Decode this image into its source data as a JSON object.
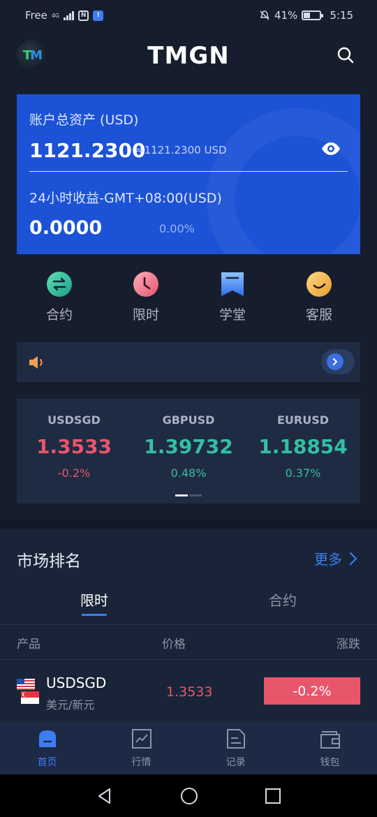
{
  "status_bar": {
    "carrier": "Free",
    "network": "4G",
    "battery": "41%",
    "time": "5:15",
    "battery_level": 0.41
  },
  "header": {
    "logo_text": "TM",
    "title": "TMGN"
  },
  "asset_card": {
    "total_label": "账户总资产 (USD)",
    "total_value": "1121.2300",
    "total_approx": "≈1121.2300 USD",
    "profit_label": "24小时收益-GMT+08:00(USD)",
    "profit_value": "0.0000",
    "profit_pct": "0.00%",
    "bg_color": "#1b52d6"
  },
  "quick_actions": [
    {
      "label": "合约",
      "icon": "swap-icon"
    },
    {
      "label": "限时",
      "icon": "clock-icon"
    },
    {
      "label": "学堂",
      "icon": "bookmark-icon"
    },
    {
      "label": "客服",
      "icon": "smile-icon"
    }
  ],
  "tickers": [
    {
      "symbol": "USDSGD",
      "price": "1.3533",
      "change": "-0.2%",
      "trend": "down"
    },
    {
      "symbol": "GBPUSD",
      "price": "1.39732",
      "change": "0.48%",
      "trend": "up"
    },
    {
      "symbol": "EURUSD",
      "price": "1.18854",
      "change": "0.37%",
      "trend": "up"
    }
  ],
  "market": {
    "title": "市场排名",
    "more": "更多",
    "tabs": [
      "限时",
      "合约"
    ],
    "active_tab": 0,
    "columns": [
      "产品",
      "价格",
      "涨跌"
    ],
    "rows": [
      {
        "name": "USDSGD",
        "sub": "美元/新元",
        "price": "1.3533",
        "change": "-0.2%"
      }
    ]
  },
  "tab_bar": [
    {
      "label": "首页",
      "icon": "home-icon",
      "active": true
    },
    {
      "label": "行情",
      "icon": "chart-icon",
      "active": false
    },
    {
      "label": "记录",
      "icon": "document-icon",
      "active": false
    },
    {
      "label": "钱包",
      "icon": "wallet-icon",
      "active": false
    }
  ],
  "colors": {
    "up": "#34bfa3",
    "down": "#e8566c",
    "accent": "#3e7cf3"
  }
}
